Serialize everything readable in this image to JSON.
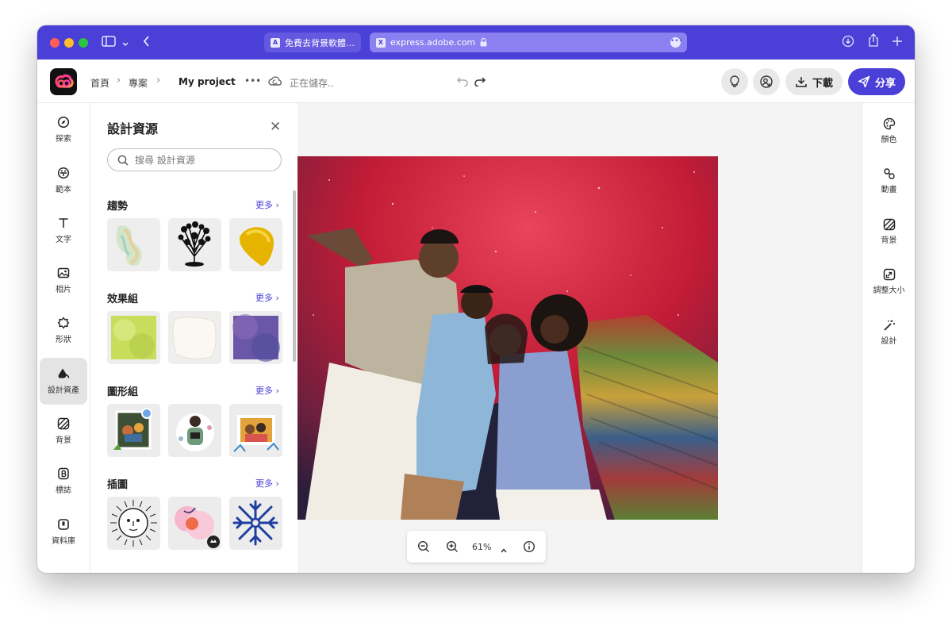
{
  "browser": {
    "tabs": [
      {
        "label": "免費去背景軟體…",
        "favicon": "A"
      },
      {
        "label": "express.adobe.com",
        "favicon": "X"
      }
    ],
    "more_glyph": "•••"
  },
  "header": {
    "breadcrumb": [
      "首頁",
      "專案",
      "My project"
    ],
    "saving_status": "正在儲存..",
    "download_label": "下載",
    "share_label": "分享"
  },
  "left_rail": [
    {
      "label": "探索",
      "icon": "compass-icon"
    },
    {
      "label": "範本",
      "icon": "template-icon"
    },
    {
      "label": "文字",
      "icon": "text-icon"
    },
    {
      "label": "相片",
      "icon": "photo-icon"
    },
    {
      "label": "形狀",
      "icon": "shape-icon"
    },
    {
      "label": "設計資產",
      "icon": "design-assets-icon",
      "active": true
    },
    {
      "label": "背景",
      "icon": "background-icon"
    },
    {
      "label": "標誌",
      "icon": "brand-icon"
    },
    {
      "label": "資料庫",
      "icon": "library-icon"
    }
  ],
  "panel": {
    "title": "設計資源",
    "search_placeholder": "搜尋 設計資源",
    "more_label": "更多 ›",
    "sections": [
      {
        "title": "趨勢"
      },
      {
        "title": "效果組"
      },
      {
        "title": "圖形組"
      },
      {
        "title": "插圖"
      }
    ]
  },
  "canvas": {
    "zoom_level": "61%"
  },
  "right_rail": [
    {
      "label": "顏色",
      "icon": "palette-icon"
    },
    {
      "label": "動畫",
      "icon": "animation-icon"
    },
    {
      "label": "背景",
      "icon": "background-icon"
    },
    {
      "label": "調整大小",
      "icon": "resize-icon"
    },
    {
      "label": "設計",
      "icon": "magic-wand-icon"
    }
  ],
  "colors": {
    "brand": "#4a3fd6",
    "chrome": "#4a3fd6"
  }
}
